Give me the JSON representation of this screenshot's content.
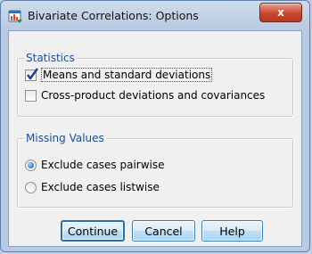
{
  "window": {
    "title": "Bivariate Correlations: Options",
    "close_label": "x"
  },
  "statistics": {
    "legend": "Statistics",
    "options": [
      {
        "label": "Means and standard deviations",
        "checked": true
      },
      {
        "label": "Cross-product deviations and covariances",
        "checked": false
      }
    ]
  },
  "missing_values": {
    "legend": "Missing Values",
    "options": [
      {
        "label": "Exclude cases pairwise",
        "selected": true
      },
      {
        "label": "Exclude cases listwise",
        "selected": false
      }
    ]
  },
  "buttons": {
    "continue": "Continue",
    "cancel": "Cancel",
    "help": "Help"
  },
  "colors": {
    "legend_text": "#1c4d9b",
    "close_button": "#c8462f",
    "button_border": "#3c7fb1"
  }
}
